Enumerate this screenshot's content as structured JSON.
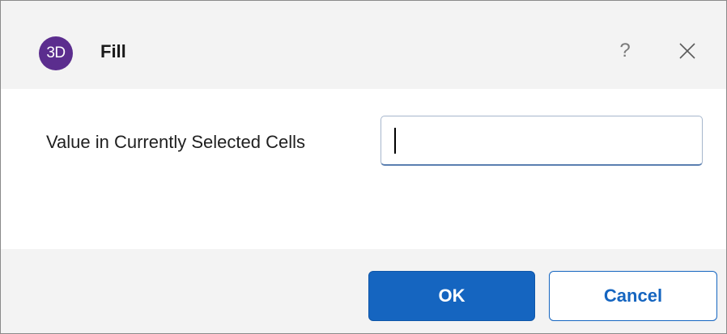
{
  "window": {
    "app_icon_text": "3D",
    "title": "Fill",
    "help_label": "?",
    "close_icon": "close-icon",
    "app_icon_color": "#5b2d8e"
  },
  "form": {
    "field_label": "Value in Currently Selected Cells",
    "field_value": "",
    "field_placeholder": ""
  },
  "buttons": {
    "ok_label": "OK",
    "cancel_label": "Cancel",
    "accent_color": "#1565c0"
  }
}
